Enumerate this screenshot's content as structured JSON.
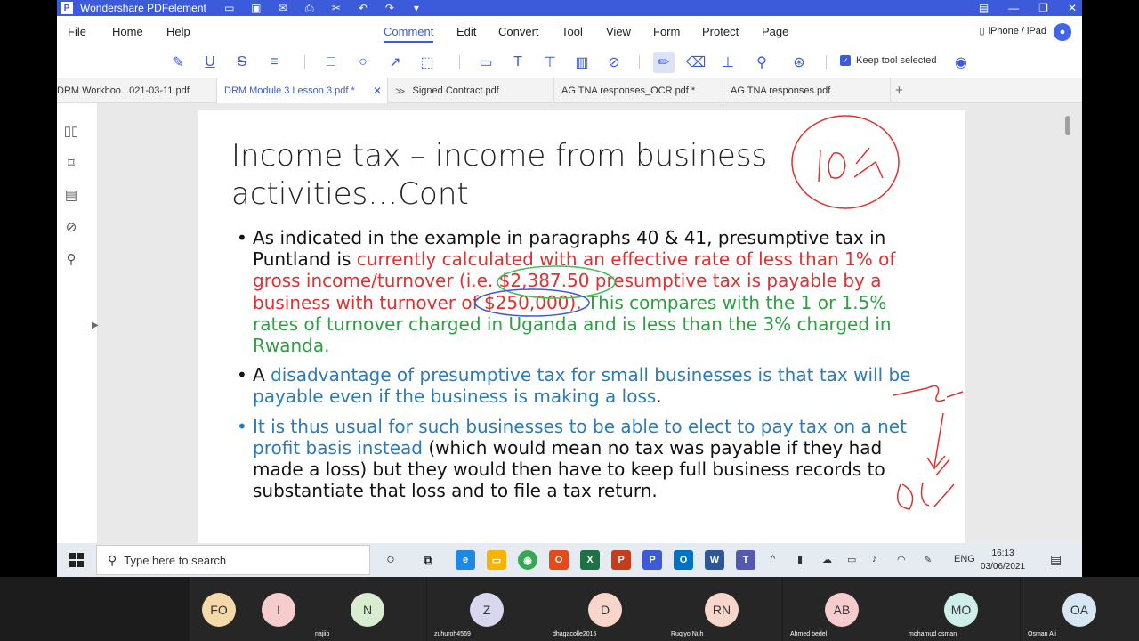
{
  "window": {
    "title": "Wondershare PDFelement",
    "logo_letter": "P"
  },
  "menu": {
    "items": [
      "File",
      "Home",
      "Help",
      "Comment",
      "Edit",
      "Convert",
      "Tool",
      "View",
      "Form",
      "Protect",
      "Page"
    ],
    "active": "Comment",
    "device_label": "iPhone / iPad"
  },
  "toolbar": {
    "keep_tool_label": "Keep tool selected",
    "keep_tool_checked": true
  },
  "tabs": [
    {
      "label": "DRM Workboo...021-03-11.pdf",
      "active": false
    },
    {
      "label": "DRM Module 3 Lesson 3.pdf *",
      "active": true
    },
    {
      "label": "Signed Contract.pdf",
      "active": false
    },
    {
      "label": "AG TNA responses_OCR.pdf *",
      "active": false
    },
    {
      "label": "AG TNA responses.pdf",
      "active": false
    }
  ],
  "slide": {
    "title_line1": "Income tax – income from business",
    "title_line2": "activities…Cont",
    "b1_black": "As indicated in the example in paragraphs 40 & 41, presumptive tax in Puntland is ",
    "b1_red": "currently calculated with an effective rate of less than 1% of gross income/turnover (i.e. $2,387.50 presumptive tax is payable by a business with turnover of $250,000).",
    "b1_green": " This compares with the 1 or 1.5% rates of turnover charged in Uganda and is less than the 3% charged in Rwanda.",
    "b2_black_a": "A ",
    "b2_blue": "disadvantage of presumptive tax for small businesses is that tax will be payable even if the business is making a loss",
    "b2_black_b": ".",
    "b3_blue": "It is thus usual for such businesses to be able to elect to pay tax on a net profit basis instead",
    "b3_black": " (which would mean no tax was payable if they had made a loss) but they would then have to keep full business records to substantiate that loss and to file a tax return."
  },
  "taskbar": {
    "search_placeholder": "Type here to search",
    "language": "ENG",
    "time": "16:13",
    "date": "03/06/2021"
  },
  "participants": [
    {
      "initials": "FO",
      "name": "",
      "color": "#f6d9a8"
    },
    {
      "initials": "I",
      "name": "",
      "color": "#f6cccc"
    },
    {
      "initials": "N",
      "name": "najiib",
      "color": "#d7ecd0"
    },
    {
      "initials": "Z",
      "name": "zuhuroh4569",
      "color": "#d7d7ee"
    },
    {
      "initials": "D",
      "name": "dhagacolle2015",
      "color": "#f8d6cc"
    },
    {
      "initials": "RN",
      "name": "Ruqiyo Nuh",
      "color": "#f8d6cc"
    },
    {
      "initials": "AB",
      "name": "Ahmed bedel",
      "color": "#f6cccc"
    },
    {
      "initials": "MO",
      "name": "mohamud osman",
      "color": "#cfeee9"
    },
    {
      "initials": "OA",
      "name": "Osman Ali",
      "color": "#d6e7f3"
    }
  ],
  "colors": {
    "accent": "#3b5bdb",
    "red_text": "#e03131",
    "green_text": "#2f9e44",
    "blue_text": "#2b7bb9"
  }
}
